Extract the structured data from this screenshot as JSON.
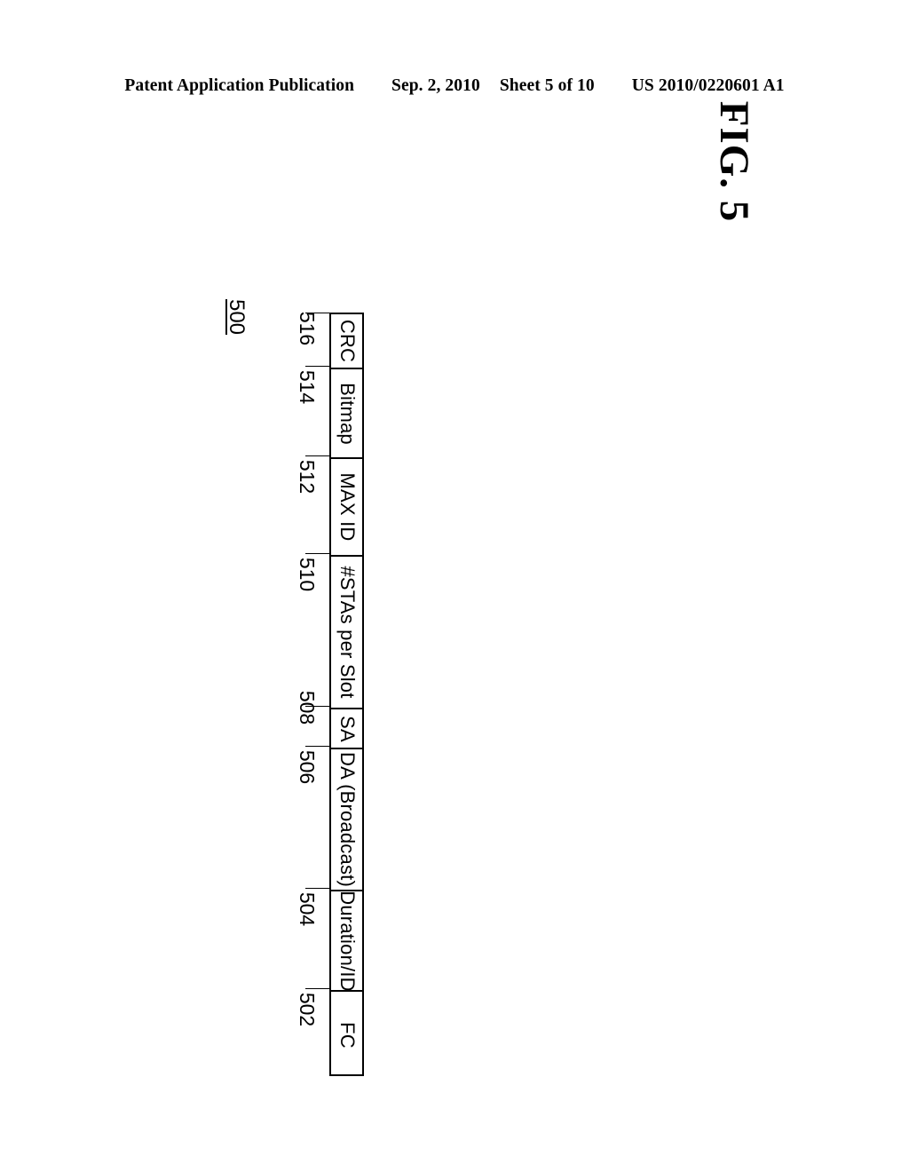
{
  "header": {
    "publication": "Patent Application Publication",
    "date": "Sep. 2, 2010",
    "sheet": "Sheet 5 of 10",
    "number": "US 2010/0220601 A1"
  },
  "figure": {
    "caption": "FIG. 5",
    "reference": "500",
    "description": "Frame format diagram rotated 90 degrees clockwise"
  },
  "chart_data": {
    "type": "table",
    "title": "FIG. 5",
    "orientation": "rotated-90-cw",
    "categories": [
      "FC",
      "Duration/ID",
      "DA (Broadcast)",
      "SA",
      "#STAs per Slot",
      "MAX ID",
      "Bitmap",
      "CRC"
    ],
    "reference_numerals": [
      "502",
      "504",
      "506",
      "508",
      "510",
      "512",
      "514",
      "516"
    ],
    "values": [
      99,
      113,
      160,
      45,
      172,
      110,
      101,
      60
    ],
    "ylabel": "",
    "xlabel": ""
  },
  "frame_fields": [
    {
      "label": "CRC",
      "ref": "516"
    },
    {
      "label": "Bitmap",
      "ref": "514"
    },
    {
      "label": "MAX ID",
      "ref": "512"
    },
    {
      "label": "#STAs per Slot",
      "ref": "510"
    },
    {
      "label": "SA",
      "ref": "508"
    },
    {
      "label": "DA (Broadcast)",
      "ref": "506"
    },
    {
      "label": "Duration/ID",
      "ref": "504"
    },
    {
      "label": "FC",
      "ref": "502"
    }
  ],
  "colors": {
    "ink": "#000000",
    "paper": "#ffffff"
  }
}
